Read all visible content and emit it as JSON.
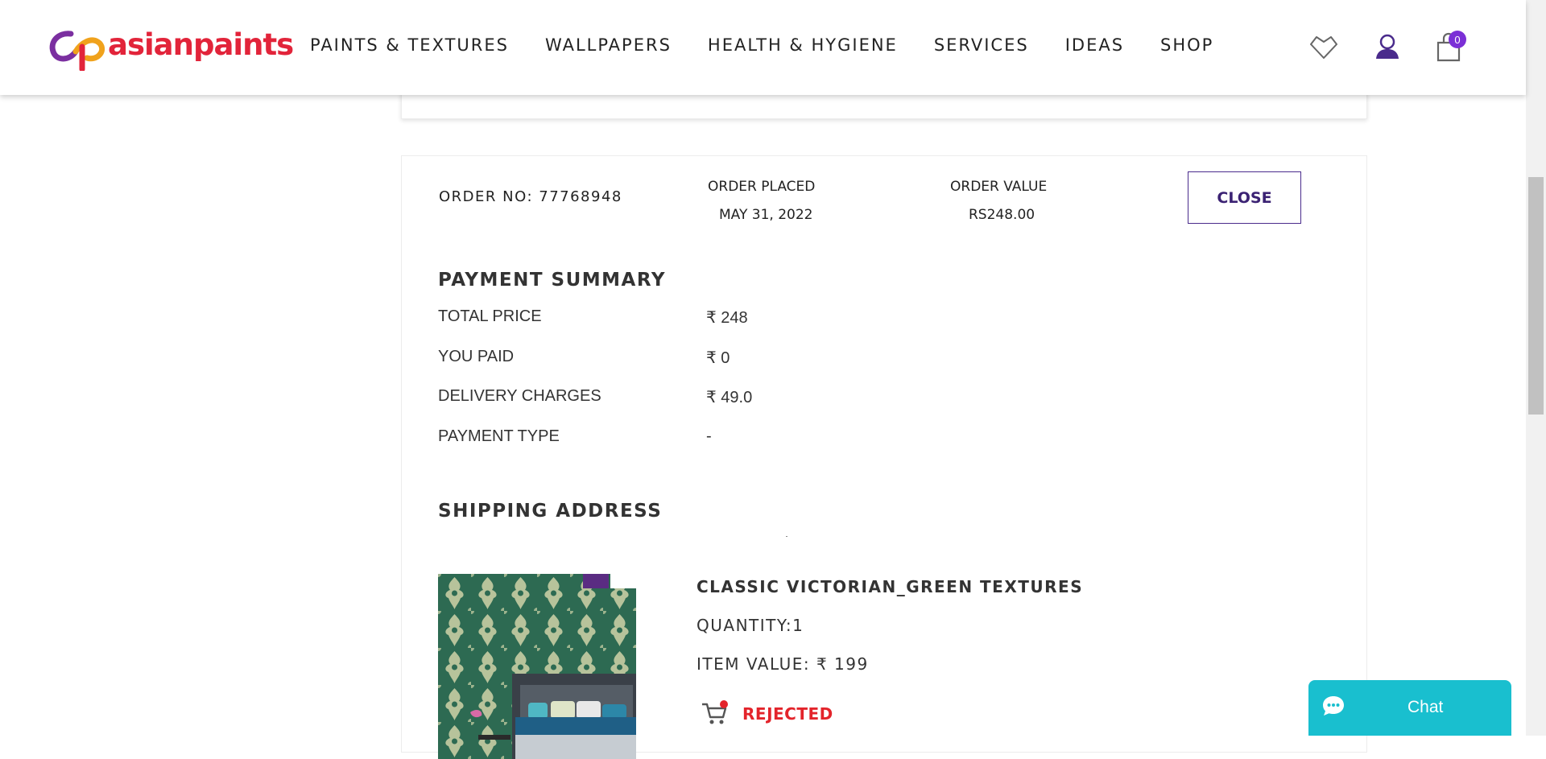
{
  "header": {
    "logo_text": "asianpaints",
    "nav": [
      {
        "label": "PAINTS & TEXTURES"
      },
      {
        "label": "WALLPAPERS"
      },
      {
        "label": "HEALTH & HYGIENE"
      },
      {
        "label": "SERVICES"
      },
      {
        "label": "IDEAS"
      },
      {
        "label": "SHOP"
      }
    ],
    "cart_count": "0",
    "icons": [
      "wishlist-heart-icon",
      "user-account-icon",
      "shopping-bag-icon"
    ]
  },
  "order": {
    "number_text": "ORDER NO: 77768948",
    "placed_label": "ORDER PLACED",
    "placed_value": "MAY 31, 2022",
    "value_label": "ORDER VALUE",
    "value_value": "RS248.00",
    "close_label": "CLOSE"
  },
  "payment": {
    "title": "PAYMENT SUMMARY",
    "rows": [
      {
        "label": "TOTAL PRICE",
        "value": "₹ 248"
      },
      {
        "label": "YOU PAID",
        "value": "₹ 0"
      },
      {
        "label": "DELIVERY CHARGES",
        "value": "₹ 49.0"
      },
      {
        "label": "PAYMENT TYPE",
        "value": "-"
      }
    ]
  },
  "shipping": {
    "title": "SHIPPING ADDRESS"
  },
  "product": {
    "title": "CLASSIC VICTORIAN_GREEN TEXTURES",
    "quantity": "QUANTITY:1",
    "item_value": "ITEM VALUE: ₹ 199",
    "status": "REJECTED",
    "status_color": "#e3242b"
  },
  "chat": {
    "label": "Chat"
  },
  "colors": {
    "brand_red": "#e2243a",
    "brand_purple": "#4a2b8c",
    "badge": "#7b2fd6",
    "chat": "#19bfcf"
  }
}
